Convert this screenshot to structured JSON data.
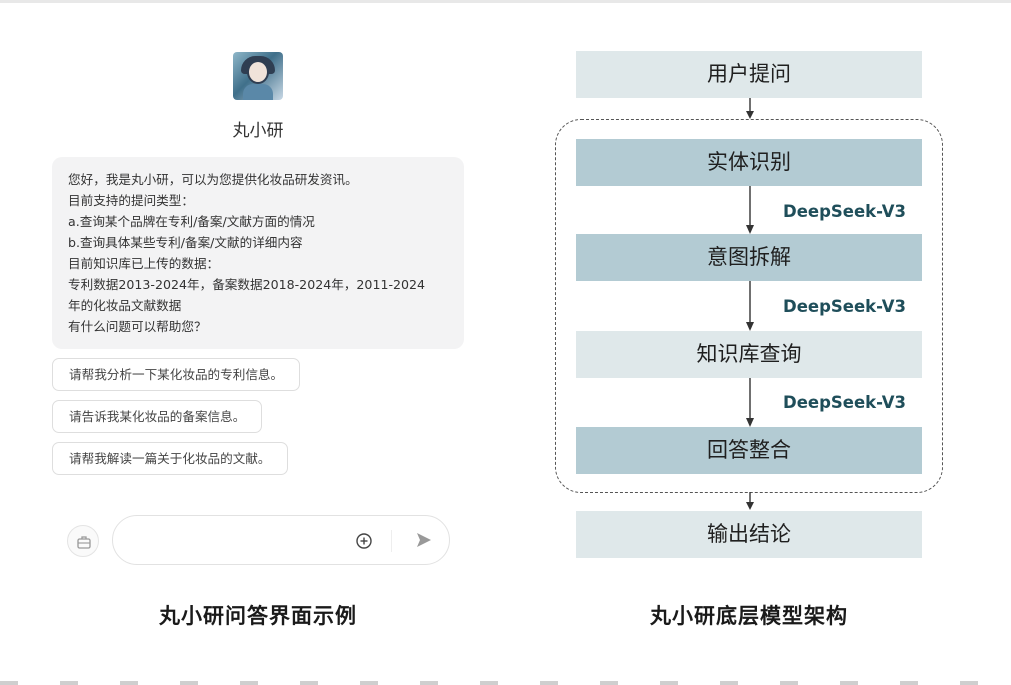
{
  "left": {
    "bot_name": "丸小研",
    "greeting_lines": [
      "您好，我是丸小研，可以为您提供化妆品研发资讯。",
      "目前支持的提问类型：",
      "a.查询某个品牌在专利/备案/文献方面的情况",
      "b.查询具体某些专利/备案/文献的详细内容",
      "目前知识库已上传的数据：",
      "专利数据2013-2024年，备案数据2018-2024年，2011-2024",
      "年的化妆品文献数据",
      "有什么问题可以帮助您？"
    ],
    "suggestions": [
      "请帮我分析一下某化妆品的专利信息。",
      "请告诉我某化妆品的备案信息。",
      "请帮我解读一篇关于化妆品的文献。"
    ],
    "icons": {
      "tool": "toolbox-icon",
      "attach": "plus-circle-icon",
      "send": "send-icon"
    },
    "caption": "丸小研问答界面示例"
  },
  "right": {
    "steps": [
      {
        "label": "用户提问",
        "tone": "light"
      },
      {
        "label": "实体识别",
        "tone": "dark"
      },
      {
        "label": "意图拆解",
        "tone": "dark"
      },
      {
        "label": "知识库查询",
        "tone": "light"
      },
      {
        "label": "回答整合",
        "tone": "dark"
      },
      {
        "label": "输出结论",
        "tone": "light"
      }
    ],
    "model_labels": [
      "DeepSeek-V3",
      "DeepSeek-V3",
      "DeepSeek-V3"
    ],
    "caption": "丸小研底层模型架构"
  }
}
